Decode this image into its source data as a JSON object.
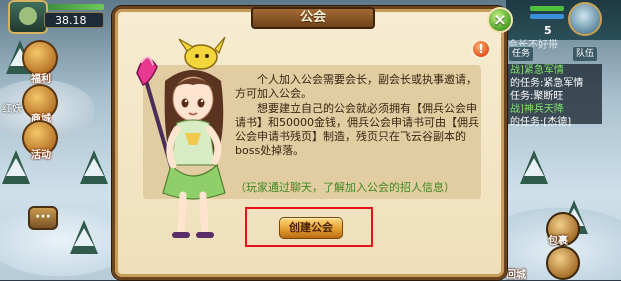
{
  "player": {
    "gold": "38.18"
  },
  "side_menu": [
    {
      "label": "福利"
    },
    {
      "label": "商城"
    },
    {
      "label": "活动"
    }
  ],
  "left_scene": {
    "partial_label": "红妖"
  },
  "chat": {
    "label": "···"
  },
  "right_hud": {
    "level": "5",
    "name_partial": "会长不好带",
    "buttons": [
      "任务",
      "队伍"
    ],
    "feed": [
      {
        "text": "战]紧急军情",
        "color": "#7fe36a"
      },
      {
        "text": "的任务:紧急军情",
        "color": "#ffffff"
      },
      {
        "text": "任务:聚断旺",
        "color": "#ffffff"
      },
      {
        "text": "战]神兵天降",
        "color": "#7fe36a"
      },
      {
        "text": "的任务:[杰德]",
        "color": "#ffffff"
      }
    ],
    "bottom_labels": [
      "包裹",
      "回城"
    ]
  },
  "dialog": {
    "title": "公会",
    "close_icon": "×",
    "info_icon": "!",
    "paragraphs": [
      "个人加入公会需要会长，副会长或执事邀请，方可加入公会。",
      "想要建立自己的公会就必须拥有【佣兵公会申请书】和50000金钱，佣兵公会申请书可由【佣兵公会申请书残页】制造，残页只在飞云谷副本的boss处掉落。"
    ],
    "hint": "（玩家通过聊天，了解加入公会的招人信息）",
    "create_button": "创建公会"
  },
  "colors": {
    "dialog_bg": "#f3e6c6",
    "frame": "#6a4320",
    "hint_green": "#3d8a1e",
    "highlight_red": "#e4141a",
    "button_gold": "#e29a2c"
  }
}
